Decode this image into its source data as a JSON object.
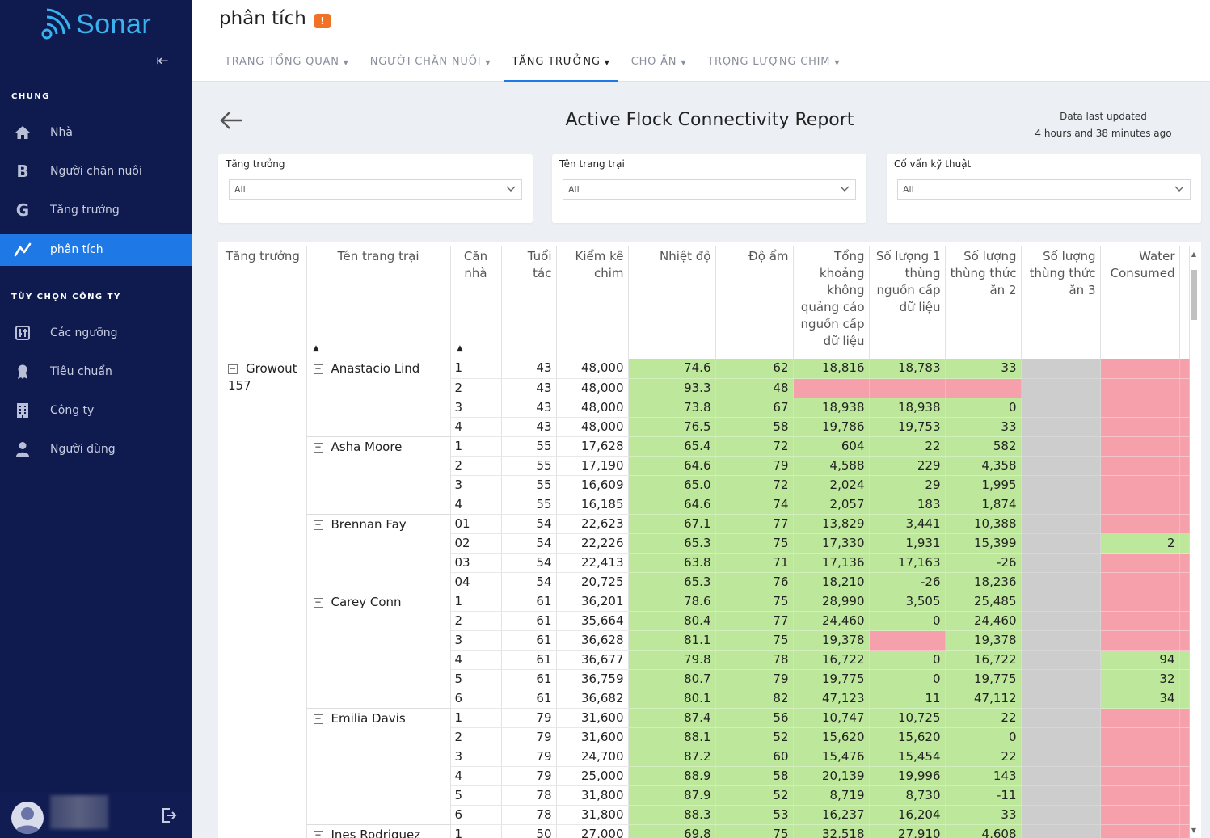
{
  "app": {
    "name": "Sonar",
    "accent": "#1e78e6",
    "sidebar_bg": "#0f1b4e"
  },
  "sidebar": {
    "section_general": "CHUNG",
    "section_company": "TÙY CHỌN CÔNG TY",
    "items": [
      {
        "label": "Nhà",
        "icon": "home-icon"
      },
      {
        "label": "Người chăn nuôi",
        "icon": "B"
      },
      {
        "label": "Tăng trưởng",
        "icon": "G"
      },
      {
        "label": "phân tích",
        "icon": "chart-line-icon",
        "active": true
      },
      {
        "label": "Các ngưỡng",
        "icon": "sliders-icon"
      },
      {
        "label": "Tiêu chuẩn",
        "icon": "award-icon"
      },
      {
        "label": "Công ty",
        "icon": "building-icon"
      },
      {
        "label": "Người dùng",
        "icon": "user-icon"
      }
    ]
  },
  "header": {
    "title": "phân tích",
    "alert": "!",
    "tabs": [
      {
        "label": "TRANG TỔNG QUAN"
      },
      {
        "label": "NGƯỜI CHĂN NUÔI"
      },
      {
        "label": "TĂNG TRƯỞNG",
        "active": true
      },
      {
        "label": "CHO ĂN"
      },
      {
        "label": "TRỌNG LƯỢNG CHIM"
      }
    ]
  },
  "report": {
    "title": "Active Flock Connectivity Report",
    "updated_line1": "Data last updated",
    "updated_line2": "4 hours and 38 minutes ago"
  },
  "filters": [
    {
      "label": "Tăng trưởng",
      "value": "All"
    },
    {
      "label": "Tên trang trại",
      "value": "All"
    },
    {
      "label": "Cố vấn kỹ thuật",
      "value": "All"
    }
  ],
  "table": {
    "columns": [
      "Tăng trưởng",
      "Tên trang trại",
      "Căn nhà",
      "Tuổi tác",
      "Kiểm kê chim",
      "Nhiệt độ",
      "Độ ẩm",
      "Tổng khoảng không quảng cáo nguồn cấp dữ liệu",
      "Số lượng 1 thùng nguồn cấp dữ liệu",
      "Số lượng thùng thức ăn 2",
      "Số lượng thùng thức ăn 3",
      "Water Consumed"
    ],
    "growouts": [
      {
        "name": "Growout 157",
        "farms": [
          {
            "name": "Anastacio Lind",
            "rows": [
              {
                "house": "1",
                "age": "43",
                "birds": "48,000",
                "temp": "74.6",
                "humidity": "62",
                "total": "18,816",
                "bin1": "18,783",
                "bin2": "33",
                "bin3": "",
                "water": ""
              },
              {
                "house": "2",
                "age": "43",
                "birds": "48,000",
                "temp": "93.3",
                "humidity": "48",
                "total": "",
                "bin1": "",
                "bin2": "",
                "bin3": "",
                "water": ""
              },
              {
                "house": "3",
                "age": "43",
                "birds": "48,000",
                "temp": "73.8",
                "humidity": "67",
                "total": "18,938",
                "bin1": "18,938",
                "bin2": "0",
                "bin3": "",
                "water": ""
              },
              {
                "house": "4",
                "age": "43",
                "birds": "48,000",
                "temp": "76.5",
                "humidity": "58",
                "total": "19,786",
                "bin1": "19,753",
                "bin2": "33",
                "bin3": "",
                "water": ""
              }
            ]
          },
          {
            "name": "Asha Moore",
            "rows": [
              {
                "house": "1",
                "age": "55",
                "birds": "17,628",
                "temp": "65.4",
                "humidity": "72",
                "total": "604",
                "bin1": "22",
                "bin2": "582",
                "bin3": "",
                "water": ""
              },
              {
                "house": "2",
                "age": "55",
                "birds": "17,190",
                "temp": "64.6",
                "humidity": "79",
                "total": "4,588",
                "bin1": "229",
                "bin2": "4,358",
                "bin3": "",
                "water": ""
              },
              {
                "house": "3",
                "age": "55",
                "birds": "16,609",
                "temp": "65.0",
                "humidity": "72",
                "total": "2,024",
                "bin1": "29",
                "bin2": "1,995",
                "bin3": "",
                "water": ""
              },
              {
                "house": "4",
                "age": "55",
                "birds": "16,185",
                "temp": "64.6",
                "humidity": "74",
                "total": "2,057",
                "bin1": "183",
                "bin2": "1,874",
                "bin3": "",
                "water": ""
              }
            ]
          },
          {
            "name": "Brennan Fay",
            "rows": [
              {
                "house": "01",
                "age": "54",
                "birds": "22,623",
                "temp": "67.1",
                "humidity": "77",
                "total": "13,829",
                "bin1": "3,441",
                "bin2": "10,388",
                "bin3": "",
                "water": ""
              },
              {
                "house": "02",
                "age": "54",
                "birds": "22,226",
                "temp": "65.3",
                "humidity": "75",
                "total": "17,330",
                "bin1": "1,931",
                "bin2": "15,399",
                "bin3": "",
                "water": "2"
              },
              {
                "house": "03",
                "age": "54",
                "birds": "22,413",
                "temp": "63.8",
                "humidity": "71",
                "total": "17,136",
                "bin1": "17,163",
                "bin2": "-26",
                "bin3": "",
                "water": ""
              },
              {
                "house": "04",
                "age": "54",
                "birds": "20,725",
                "temp": "65.3",
                "humidity": "76",
                "total": "18,210",
                "bin1": "-26",
                "bin2": "18,236",
                "bin3": "",
                "water": ""
              }
            ]
          },
          {
            "name": "Carey Conn",
            "rows": [
              {
                "house": "1",
                "age": "61",
                "birds": "36,201",
                "temp": "78.6",
                "humidity": "75",
                "total": "28,990",
                "bin1": "3,505",
                "bin2": "25,485",
                "bin3": "",
                "water": ""
              },
              {
                "house": "2",
                "age": "61",
                "birds": "35,664",
                "temp": "80.4",
                "humidity": "77",
                "total": "24,460",
                "bin1": "0",
                "bin2": "24,460",
                "bin3": "",
                "water": ""
              },
              {
                "house": "3",
                "age": "61",
                "birds": "36,628",
                "temp": "81.1",
                "humidity": "75",
                "total": "19,378",
                "bin1": "",
                "bin2": "19,378",
                "bin3": "",
                "water": ""
              },
              {
                "house": "4",
                "age": "61",
                "birds": "36,677",
                "temp": "79.8",
                "humidity": "78",
                "total": "16,722",
                "bin1": "0",
                "bin2": "16,722",
                "bin3": "",
                "water": "94"
              },
              {
                "house": "5",
                "age": "61",
                "birds": "36,759",
                "temp": "80.7",
                "humidity": "79",
                "total": "19,775",
                "bin1": "0",
                "bin2": "19,775",
                "bin3": "",
                "water": "32"
              },
              {
                "house": "6",
                "age": "61",
                "birds": "36,682",
                "temp": "80.1",
                "humidity": "82",
                "total": "47,123",
                "bin1": "11",
                "bin2": "47,112",
                "bin3": "",
                "water": "34"
              }
            ]
          },
          {
            "name": "Emilia Davis",
            "rows": [
              {
                "house": "1",
                "age": "79",
                "birds": "31,600",
                "temp": "87.4",
                "humidity": "56",
                "total": "10,747",
                "bin1": "10,725",
                "bin2": "22",
                "bin3": "",
                "water": ""
              },
              {
                "house": "2",
                "age": "79",
                "birds": "31,600",
                "temp": "88.1",
                "humidity": "52",
                "total": "15,620",
                "bin1": "15,620",
                "bin2": "0",
                "bin3": "",
                "water": ""
              },
              {
                "house": "3",
                "age": "79",
                "birds": "24,700",
                "temp": "87.2",
                "humidity": "60",
                "total": "15,476",
                "bin1": "15,454",
                "bin2": "22",
                "bin3": "",
                "water": ""
              },
              {
                "house": "4",
                "age": "79",
                "birds": "25,000",
                "temp": "88.9",
                "humidity": "58",
                "total": "20,139",
                "bin1": "19,996",
                "bin2": "143",
                "bin3": "",
                "water": ""
              },
              {
                "house": "5",
                "age": "78",
                "birds": "31,800",
                "temp": "87.9",
                "humidity": "52",
                "total": "8,719",
                "bin1": "8,730",
                "bin2": "-11",
                "bin3": "",
                "water": ""
              },
              {
                "house": "6",
                "age": "78",
                "birds": "31,800",
                "temp": "88.3",
                "humidity": "53",
                "total": "16,237",
                "bin1": "16,204",
                "bin2": "33",
                "bin3": "",
                "water": ""
              }
            ]
          },
          {
            "name": "Ines Rodriguez",
            "rows": [
              {
                "house": "1",
                "age": "50",
                "birds": "27,000",
                "temp": "69.8",
                "humidity": "75",
                "total": "32,518",
                "bin1": "27,910",
                "bin2": "4,608",
                "bin3": "",
                "water": ""
              }
            ]
          }
        ]
      }
    ]
  },
  "colors": {
    "ok": "#bde89b",
    "alert": "#f6a0ab",
    "missing": "#cdcdcd"
  }
}
